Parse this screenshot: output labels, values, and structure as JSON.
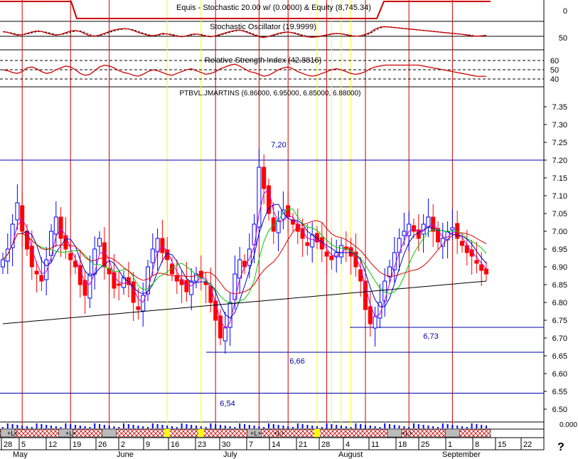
{
  "help_glyph": "?",
  "chart_data": {
    "type": "candlestick-with-indicators",
    "title": "Equis - Stochastic 20.00 w/ (0.0000) & Equity (8,745.34)",
    "colors": {
      "bull": "#0000ff",
      "bear": "#ff0000",
      "stoch": "#cc0000",
      "ma_fast": "#cc00cc",
      "ma_blue": "#0000cc",
      "ma_green": "#00cc00",
      "ma_red": "#dd0000",
      "ma_long": "#000000",
      "signal_red": "#cc0000",
      "signal_yellow": "#ffff00",
      "level_line": "#0000aa"
    },
    "equity": {
      "title": "Equis - Stochastic 20.00 w/ (0.0000) & Equity (8,745.34)",
      "ytick": "0"
    },
    "stochastic": {
      "title": "Stochastic Oscillator (19.9999)",
      "ytick": "50",
      "k": [
        70,
        66,
        60,
        55,
        56,
        62,
        68,
        72,
        70,
        64,
        58,
        55,
        58,
        65,
        72,
        74,
        70,
        60,
        52,
        50,
        55,
        62,
        70,
        76,
        80,
        82,
        80,
        74,
        66,
        60,
        54,
        52,
        56,
        62,
        60,
        55,
        50,
        48,
        52,
        58,
        60,
        56,
        50,
        48,
        52,
        58,
        64,
        70,
        74,
        76,
        70,
        62,
        55,
        48,
        45,
        50,
        56,
        62,
        66,
        68,
        64,
        58,
        52,
        48,
        46,
        48,
        52,
        56,
        60,
        62,
        60,
        56,
        52,
        50,
        52,
        58,
        66,
        80,
        88,
        90,
        88,
        86,
        84,
        82,
        80,
        78,
        76,
        74,
        72,
        70,
        68,
        66,
        64,
        62,
        60,
        58,
        55,
        52,
        50,
        52,
        54
      ],
      "d": [
        68,
        67,
        63,
        58,
        56,
        59,
        64,
        69,
        70,
        67,
        62,
        57,
        57,
        61,
        67,
        71,
        72,
        66,
        57,
        52,
        53,
        58,
        66,
        72,
        77,
        80,
        81,
        77,
        70,
        63,
        57,
        53,
        54,
        58,
        60,
        58,
        53,
        49,
        50,
        55,
        59,
        58,
        53,
        49,
        50,
        55,
        61,
        67,
        72,
        75,
        73,
        66,
        58,
        51,
        47,
        48,
        53,
        59,
        64,
        67,
        66,
        61,
        55,
        50,
        47,
        47,
        50,
        54,
        58,
        61,
        61,
        58,
        54,
        51,
        51,
        55,
        62,
        74,
        84,
        89,
        89,
        87,
        85,
        83,
        81,
        79,
        77,
        75,
        73,
        71,
        69,
        67,
        65,
        63,
        61,
        59,
        57,
        54,
        51,
        51,
        53
      ]
    },
    "rsi": {
      "title": "Relative Strength Index (42.8816)",
      "yticks": [
        "60",
        "50",
        "40"
      ],
      "values": [
        50,
        49,
        47,
        46,
        48,
        52,
        53,
        51,
        48,
        46,
        47,
        50,
        52,
        54,
        53,
        50,
        46,
        44,
        45,
        49,
        53,
        55,
        54,
        52,
        49,
        47,
        46,
        44,
        43,
        45,
        48,
        50,
        49,
        47,
        45,
        44,
        46,
        48,
        50,
        51,
        49,
        47,
        45,
        46,
        48,
        51,
        53,
        55,
        56,
        54,
        51,
        48,
        47,
        45,
        43,
        44,
        47,
        50,
        52,
        53,
        51,
        48,
        46,
        44,
        43,
        44,
        46,
        48,
        50,
        51,
        50,
        48,
        46,
        45,
        46,
        48,
        51,
        53,
        54,
        55,
        55,
        55,
        55,
        55,
        55,
        55,
        55,
        54,
        53,
        52,
        51,
        50,
        49,
        48,
        47,
        46,
        45,
        44,
        43,
        42.9,
        42.9
      ]
    },
    "price": {
      "title": "PTBVL.JMARTINS (6.86000, 6.95000, 6.85000, 6.88000)",
      "ymin": 6.45,
      "ymax": 7.375,
      "yticks": [
        "7.35",
        "7.30",
        "7.25",
        "7.20",
        "7.15",
        "7.10",
        "7.05",
        "7.00",
        "6.95",
        "6.90",
        "6.85",
        "6.80",
        "6.75",
        "6.70",
        "6.65",
        "6.60",
        "6.55",
        "6.50"
      ],
      "closes": [
        6.92,
        6.95,
        7.02,
        7.08,
        7.0,
        6.95,
        6.9,
        6.88,
        6.86,
        6.92,
        7.0,
        7.04,
        6.98,
        6.95,
        6.92,
        6.9,
        6.85,
        6.82,
        6.88,
        6.95,
        6.98,
        6.9,
        6.88,
        6.84,
        6.85,
        6.87,
        6.85,
        6.8,
        6.78,
        6.82,
        6.9,
        6.95,
        6.98,
        6.94,
        6.92,
        6.88,
        6.86,
        6.85,
        6.83,
        6.86,
        6.88,
        6.87,
        6.85,
        6.8,
        6.75,
        6.7,
        6.73,
        6.8,
        6.88,
        6.92,
        6.9,
        6.95,
        7.02,
        7.18,
        7.12,
        7.05,
        7.0,
        7.03,
        7.06,
        7.04,
        7.02,
        7.0,
        6.98,
        6.96,
        6.99,
        6.97,
        6.95,
        6.93,
        6.92,
        6.94,
        6.96,
        6.95,
        6.93,
        6.9,
        6.86,
        6.78,
        6.74,
        6.76,
        6.8,
        6.86,
        6.9,
        6.94,
        6.98,
        7.0,
        7.02,
        7.0,
        6.98,
        7.02,
        7.04,
        7.0,
        6.97,
        6.98,
        7.0,
        7.01,
        6.98,
        6.96,
        6.94,
        6.93,
        6.91,
        6.89,
        6.88
      ],
      "levels": [
        {
          "value": 7.2,
          "label": "7,20"
        },
        {
          "value": 6.73,
          "label": "6,73"
        },
        {
          "value": 6.66,
          "label": "6,66"
        },
        {
          "value": 6.545,
          "label": "6,54"
        }
      ]
    },
    "volume": {
      "ytick": "0.000"
    },
    "signals": {
      "red": [
        4,
        14,
        22,
        44,
        53,
        59,
        67,
        75,
        84,
        93
      ],
      "yellow": [
        34,
        41,
        65,
        68,
        70,
        72
      ]
    },
    "signal_strip": [
      "+L+",
      "+L+",
      "+L+",
      "+L+",
      "+L+"
    ],
    "x_axis": {
      "day_labels": [
        "28",
        "5",
        "12",
        "19",
        "26",
        "2",
        "9",
        "16",
        "23",
        "30",
        "7",
        "14",
        "21",
        "28",
        "4",
        "11",
        "18",
        "25",
        "1",
        "8",
        "15",
        "22"
      ],
      "month_labels": [
        "May",
        "June",
        "July",
        "August",
        "September"
      ]
    }
  }
}
